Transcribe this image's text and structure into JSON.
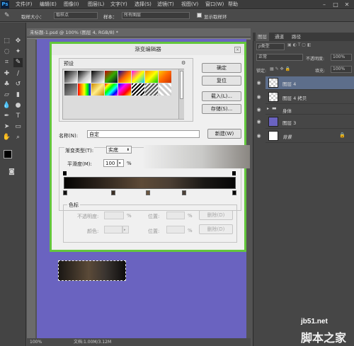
{
  "menubar": {
    "logo": "Ps",
    "items": [
      "文件(F)",
      "编辑(E)",
      "图像(I)",
      "图层(L)",
      "文字(Y)",
      "选择(S)",
      "滤镜(T)",
      "视图(V)",
      "窗口(W)",
      "帮助"
    ]
  },
  "options": {
    "sample_size_label": "取样大小：",
    "sample_size_value": "取样点",
    "sample_label": "样本：",
    "sample_value": "所有图层",
    "show_ring_label": "显示取样环"
  },
  "document": {
    "tab_title": "未标题-1.psd @ 100% (图层 4, RGB/8) *",
    "zoom": "100%",
    "doc_info": "文档:1.00M/3.12M"
  },
  "dialog": {
    "title": "渐变编辑器",
    "presets_label": "预设",
    "ok_label": "确定",
    "reset_label": "复位",
    "load_label": "载入(L)...",
    "save_label": "存储(S)...",
    "name_label": "名称(N):",
    "name_value": "自定",
    "new_label": "新建(W)",
    "gradient_type_label": "渐变类型(T):",
    "gradient_type_value": "实底",
    "smoothness_label": "平滑度(M):",
    "smoothness_value": "100",
    "smoothness_unit": "%",
    "color_stops_label": "色标",
    "opacity_label": "不透明度:",
    "opacity_unit": "%",
    "location_label": "位置:",
    "location_unit": "%",
    "delete_label": "删除(D)",
    "color_label": "颜色:",
    "location2_label": "位置:",
    "location2_unit": "%",
    "delete2_label": "删除(D)"
  },
  "layers_panel": {
    "tabs": [
      "图层",
      "通道",
      "路径"
    ],
    "filter_label": "ρ类型",
    "blend_mode": "正常",
    "opacity_label": "不透明度:",
    "opacity_value": "100%",
    "lock_label": "锁定:",
    "fill_label": "填充:",
    "fill_value": "100%",
    "layers": [
      {
        "name": "图层 4",
        "selected": true
      },
      {
        "name": "图层 4 拷贝",
        "selected": false
      },
      {
        "name": "身体",
        "selected": false
      },
      {
        "name": "图层 3",
        "selected": false
      },
      {
        "name": "背景",
        "selected": false
      }
    ]
  },
  "watermark": {
    "site": "jb51.net",
    "name": "脚本之家"
  },
  "colors": {
    "canvas": "#6a63c0",
    "dialog_border": "#63c63c",
    "layer_selected": "#5d6e8b"
  }
}
